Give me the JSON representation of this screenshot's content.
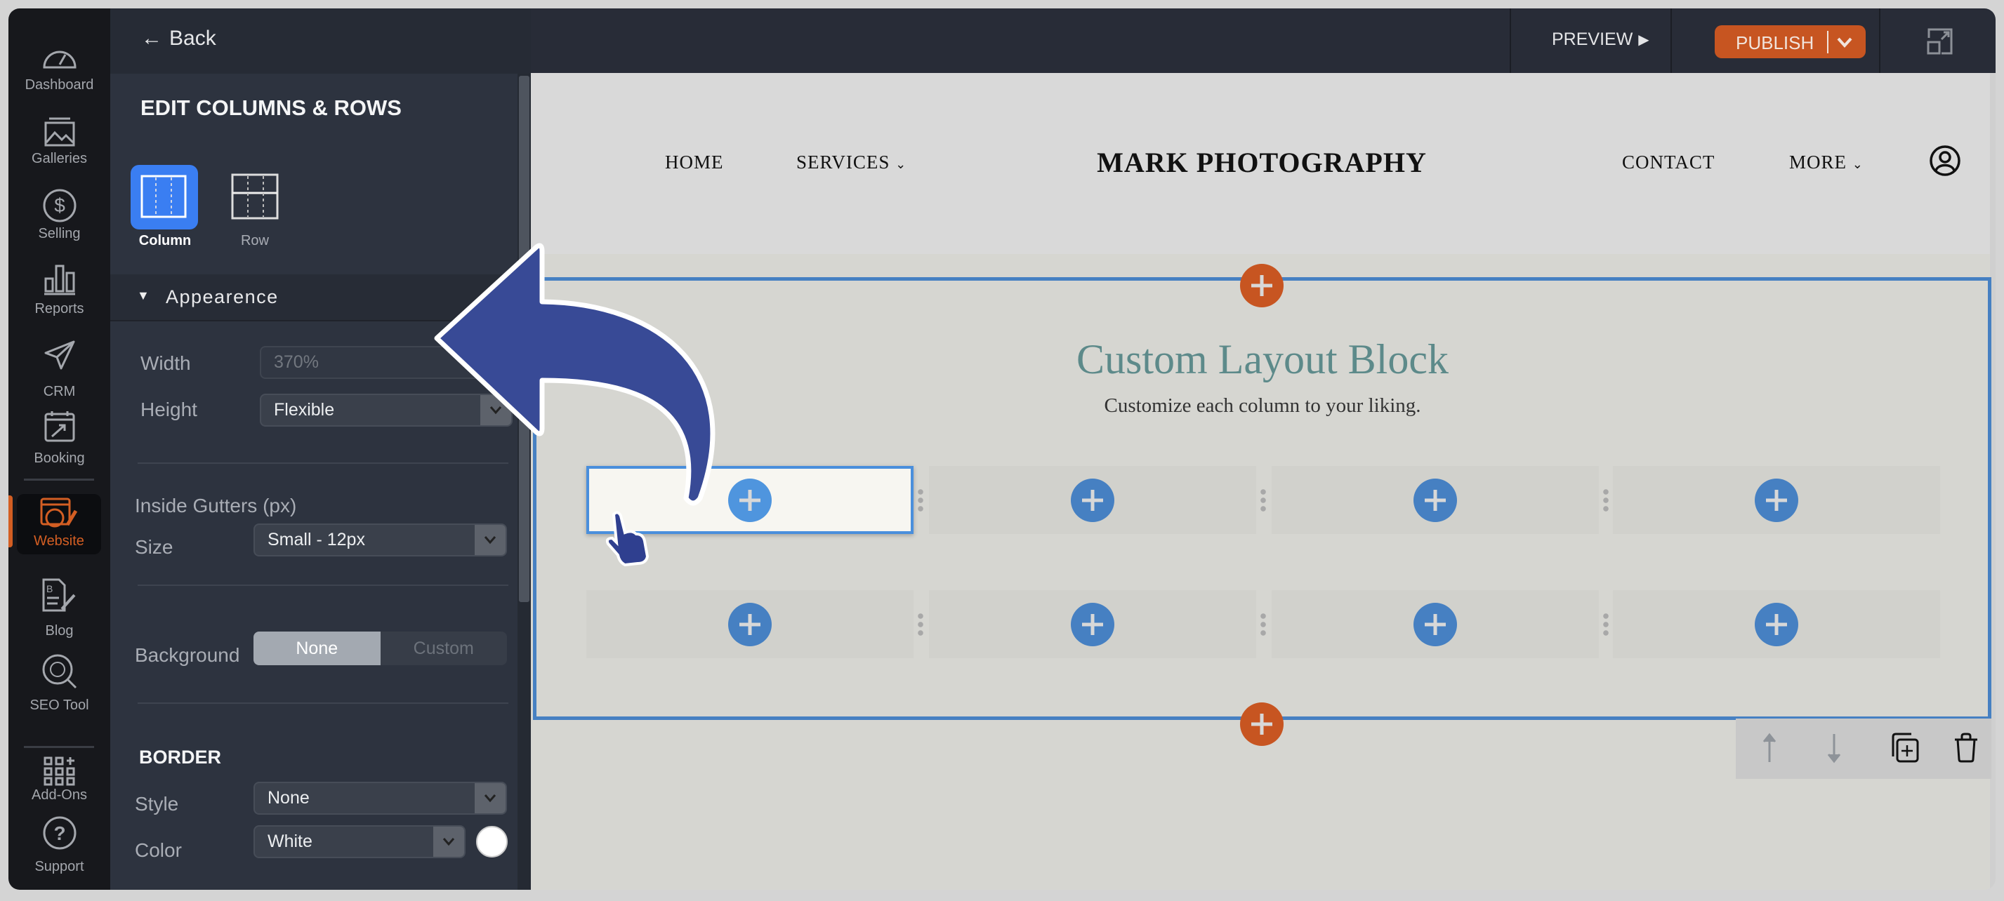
{
  "leftnav": {
    "items": [
      {
        "label": "Dashboard",
        "icon": "dashboard-gauge-icon"
      },
      {
        "label": "Galleries",
        "icon": "gallery-image-icon"
      },
      {
        "label": "Selling",
        "icon": "dollar-circle-icon"
      },
      {
        "label": "Reports",
        "icon": "bar-chart-icon"
      },
      {
        "label": "CRM",
        "icon": "paper-plane-icon"
      },
      {
        "label": "Booking",
        "icon": "calendar-icon"
      },
      {
        "label": "Website",
        "icon": "website-globe-pencil-icon",
        "active": true
      },
      {
        "label": "Blog",
        "icon": "blog-document-icon"
      },
      {
        "label": "SEO Tool",
        "icon": "seo-globe-search-icon"
      },
      {
        "label": "Add-Ons",
        "icon": "add-ons-grid-icon"
      },
      {
        "label": "Support",
        "icon": "help-circle-icon"
      }
    ],
    "active_color": "#d35e23"
  },
  "panel": {
    "back_label": "Back",
    "title": "EDIT COLUMNS & ROWS",
    "modes": [
      {
        "label": "Column",
        "selected": true
      },
      {
        "label": "Row",
        "selected": false
      }
    ],
    "appearance_label": "Appearence",
    "width_label": "Width",
    "width_value": "370%",
    "height_label": "Height",
    "height_value": "Flexible",
    "gutters_label": "Inside Gutters (px)",
    "size_label": "Size",
    "size_value": "Small - 12px",
    "background_label": "Background",
    "background_options": [
      "None",
      "Custom"
    ],
    "background_selected": "None",
    "border_title": "BORDER",
    "style_label": "Style",
    "style_value": "None",
    "color_label": "Color",
    "color_value": "White",
    "color_swatch": "#ffffff"
  },
  "topbar": {
    "preview_label": "PREVIEW",
    "publish_label": "PUBLISH",
    "publish_color": "#c75521"
  },
  "site": {
    "nav_left": [
      "HOME",
      "SERVICES"
    ],
    "logo": "MARK PHOTOGRAPHY",
    "nav_right": [
      "CONTACT",
      "MORE"
    ],
    "block_title": "Custom Layout Block",
    "block_subtitle": "Customize each column to your liking.",
    "rows": 2,
    "columns": 4,
    "selected_cell": "row 1, column 1",
    "accent": "#4680c2"
  },
  "block_toolbar": {
    "icons": [
      "move-up-arrow-icon",
      "move-down-arrow-icon",
      "duplicate-icon",
      "trash-icon"
    ]
  }
}
